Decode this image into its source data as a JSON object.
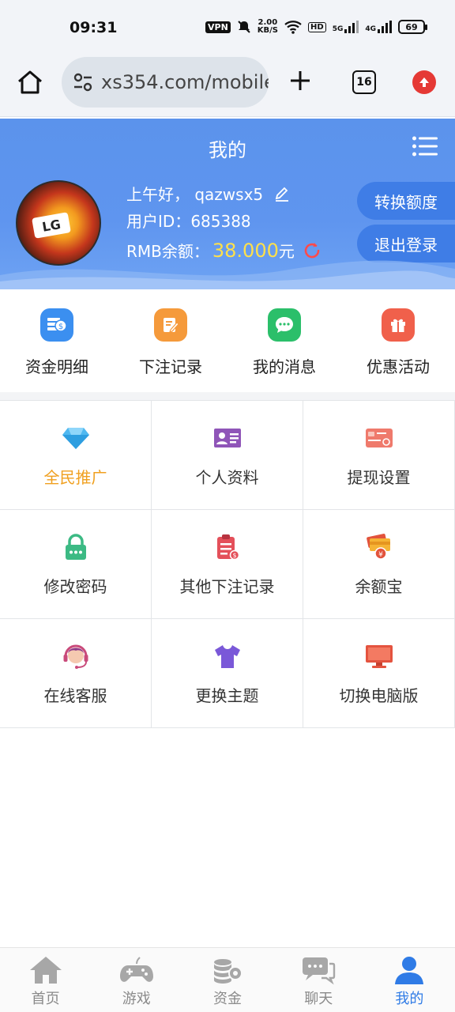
{
  "status_bar": {
    "time": "09:31",
    "vpn": "VPN",
    "speed_value": "2.00",
    "speed_unit": "KB/S",
    "hd": "HD",
    "net1": "5G",
    "net2": "4G",
    "battery": "69"
  },
  "browser": {
    "url": "xs354.com/mobile",
    "tab_count": "16"
  },
  "header": {
    "title": "我的",
    "greeting": "上午好，",
    "username": "qazwsx5",
    "uid_label": "用户ID：",
    "uid": "685388",
    "balance_label": "RMB余额：",
    "balance": "38.000",
    "currency": "元",
    "convert_button": "转换额度",
    "logout_button": "退出登录",
    "avatar_text": "LG"
  },
  "quick_actions": [
    {
      "label": "资金明细",
      "icon": "money-icon",
      "color": "#3b8ff0"
    },
    {
      "label": "下注记录",
      "icon": "bet-record-icon",
      "color": "#f59a3b"
    },
    {
      "label": "我的消息",
      "icon": "message-icon",
      "color": "#2bbf6a"
    },
    {
      "label": "优惠活动",
      "icon": "gift-icon",
      "color": "#f0604b"
    }
  ],
  "grid": [
    {
      "label": "全民推广",
      "icon": "diamond-icon",
      "highlight": true
    },
    {
      "label": "个人资料",
      "icon": "id-card-icon"
    },
    {
      "label": "提现设置",
      "icon": "bank-card-icon"
    },
    {
      "label": "修改密码",
      "icon": "lock-icon"
    },
    {
      "label": "其他下注记录",
      "icon": "clipboard-icon"
    },
    {
      "label": "余额宝",
      "icon": "wallet-icon"
    },
    {
      "label": "在线客服",
      "icon": "headset-icon"
    },
    {
      "label": "更换主题",
      "icon": "shirt-icon"
    },
    {
      "label": "切换电脑版",
      "icon": "monitor-icon"
    }
  ],
  "tabbar": [
    {
      "label": "首页",
      "icon": "home-icon"
    },
    {
      "label": "游戏",
      "icon": "gamepad-icon"
    },
    {
      "label": "资金",
      "icon": "coins-icon"
    },
    {
      "label": "聊天",
      "icon": "chat-icon"
    },
    {
      "label": "我的",
      "icon": "user-icon",
      "active": true
    }
  ]
}
